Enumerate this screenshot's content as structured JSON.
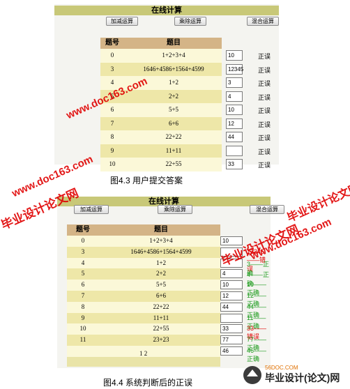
{
  "top": {
    "title": "在线计算",
    "buttons": [
      "加减运算",
      "乘除运算",
      "混合运算"
    ],
    "header": [
      "题号",
      "题目"
    ],
    "rows": [
      {
        "no": "0",
        "q": "1+2+3+4",
        "ans": "10",
        "res": "正误"
      },
      {
        "no": "3",
        "q": "1646+4586+1564+4599",
        "ans": "12345",
        "res": "正误"
      },
      {
        "no": "4",
        "q": "1+2",
        "ans": "3",
        "res": "正误"
      },
      {
        "no": "5",
        "q": "2+2",
        "ans": "4",
        "res": "正误"
      },
      {
        "no": "6",
        "q": "5+5",
        "ans": "10",
        "res": "正误"
      },
      {
        "no": "7",
        "q": "6+6",
        "ans": "12",
        "res": "正误"
      },
      {
        "no": "8",
        "q": "22+22",
        "ans": "44",
        "res": "正误"
      },
      {
        "no": "9",
        "q": "11+11",
        "ans": "",
        "res": "正误"
      },
      {
        "no": "10",
        "q": "22+55",
        "ans": "33",
        "res": "正误"
      }
    ],
    "caption": "图4.3  用户提交答案"
  },
  "bottom": {
    "title": "在线计算",
    "buttons": [
      "加减运算",
      "乘除运算",
      "混合运算"
    ],
    "header": [
      "题号",
      "题目"
    ],
    "rows": [
      {
        "no": "0",
        "q": "1+2+3+4",
        "ans": "10",
        "res": "",
        "status": "ok"
      },
      {
        "no": "3",
        "q": "1646+4586+1564+4599",
        "ans": "",
        "res": "12345——错误",
        "status": "err"
      },
      {
        "no": "4",
        "q": "1+2",
        "ans": "",
        "res": "3——正确",
        "status": "ok"
      },
      {
        "no": "5",
        "q": "2+2",
        "ans": "4",
        "res": "4——正确",
        "status": "ok"
      },
      {
        "no": "6",
        "q": "5+5",
        "ans": "10",
        "res": "10——正确",
        "status": "ok"
      },
      {
        "no": "7",
        "q": "6+6",
        "ans": "12",
        "res": "12——正确",
        "status": "ok"
      },
      {
        "no": "8",
        "q": "22+22",
        "ans": "44",
        "res": "44——正确",
        "status": "ok"
      },
      {
        "no": "9",
        "q": "11+11",
        "ans": "",
        "res": "11——正确",
        "status": "ok"
      },
      {
        "no": "10",
        "q": "22+55",
        "ans": "33",
        "res": "33——错误",
        "status": "err"
      },
      {
        "no": "11",
        "q": "23+23",
        "ans": "77",
        "res": "77——正确",
        "status": "ok"
      },
      {
        "no": "",
        "q": "",
        "ans": "46",
        "res": "46——正确",
        "status": "ok"
      }
    ],
    "pager": "1 2",
    "caption": "图4.4  系统判断后的正误"
  },
  "watermarks": {
    "site_text": "www.doc163.com",
    "brand_text": "毕业设计论文网",
    "logo_text": "毕业设计(论文)网",
    "logo_small": "56DOC.COM"
  },
  "colors": {
    "ok": "#1a9a1a",
    "err": "#e00000",
    "watermark": "#e00000"
  }
}
